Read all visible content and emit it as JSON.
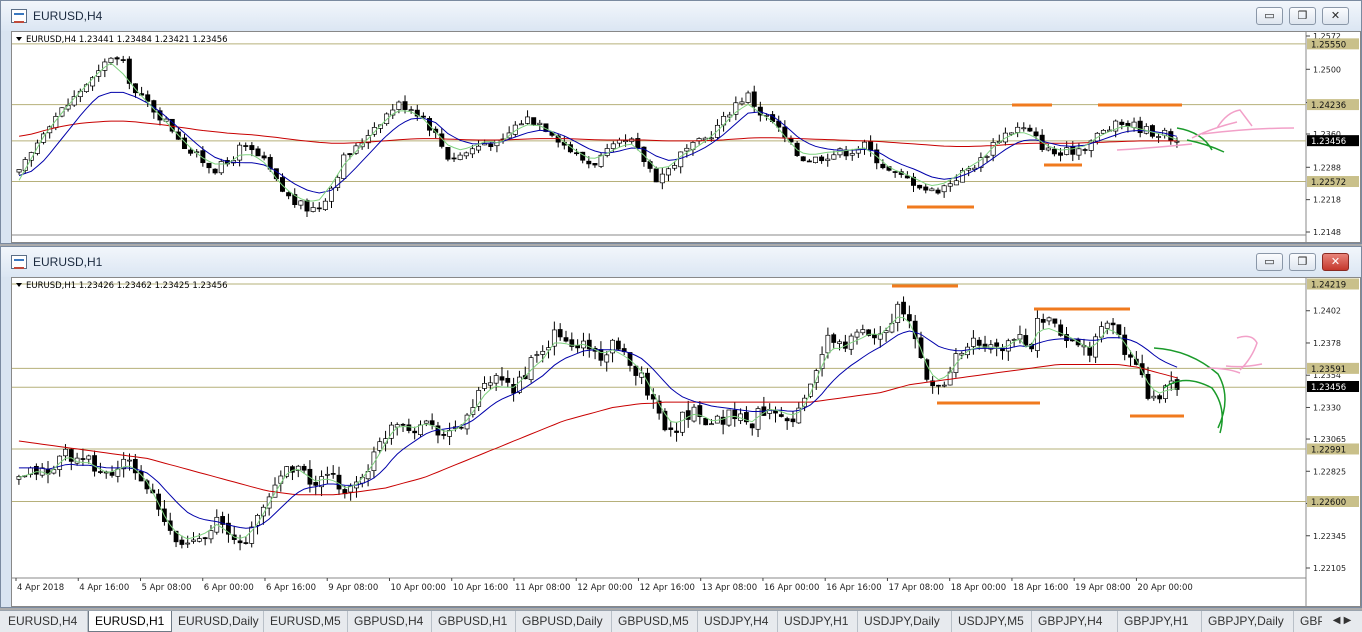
{
  "windows": [
    {
      "title": "EURUSD,H4",
      "info": "EURUSD,H4  1.23441 1.23484 1.23421 1.23456",
      "buttons": {
        "minimize": "▭",
        "maximize": "❐",
        "close": "✕"
      },
      "chart_data": {
        "type": "candlestick",
        "symbol": "EURUSD",
        "timeframe": "H4",
        "ohlc_current": {
          "open": 1.23441,
          "high": 1.23484,
          "low": 1.23421,
          "close": 1.23456
        },
        "ylim": [
          1.2148,
          1.2572
        ],
        "y_ticks": [
          1.2572,
          1.25,
          1.2428,
          1.236,
          1.2288,
          1.2218,
          1.2148
        ],
        "price_labels": [
          {
            "value": 1.2555,
            "text": "1.25550",
            "style": "level"
          },
          {
            "value": 1.24236,
            "text": "1.24236",
            "style": "level"
          },
          {
            "value": 1.23456,
            "text": "1.23456",
            "style": "current"
          },
          {
            "value": 1.22572,
            "text": "1.22572",
            "style": "level"
          }
        ],
        "horizontal_levels": [
          1.2555,
          1.24236,
          1.2345,
          1.22572
        ],
        "candle_count": 190,
        "close_path": [
          1.2275,
          1.232,
          1.2375,
          1.2405,
          1.243,
          1.2465,
          1.2485,
          1.253,
          1.251,
          1.2445,
          1.2425,
          1.2395,
          1.2365,
          1.2325,
          1.2305,
          1.2285,
          1.2295,
          1.233,
          1.232,
          1.2295,
          1.2245,
          1.2215,
          1.22,
          1.22,
          1.2245,
          1.231,
          1.233,
          1.237,
          1.2395,
          1.2425,
          1.242,
          1.24,
          1.236,
          1.231,
          1.2315,
          1.233,
          1.2345,
          1.2335,
          1.2375,
          1.2395,
          1.2385,
          1.2365,
          1.2335,
          1.231,
          1.2295,
          1.2315,
          1.2335,
          1.2345,
          1.2305,
          1.2265,
          1.2285,
          1.232,
          1.2335,
          1.2355,
          1.2385,
          1.2425,
          1.2445,
          1.2405,
          1.2385,
          1.2345,
          1.231,
          1.2305,
          1.2315,
          1.232,
          1.2325,
          1.2335,
          1.2305,
          1.2275,
          1.2265,
          1.2255,
          1.2235,
          1.2245,
          1.2265,
          1.2285,
          1.2305,
          1.2345,
          1.2365,
          1.2375,
          1.2355,
          1.2325,
          1.2315,
          1.2325,
          1.2335,
          1.236,
          1.2375,
          1.2385,
          1.2375,
          1.2365,
          1.236,
          1.2345
        ],
        "ma_fast_path": [
          1.226,
          1.231,
          1.236,
          1.2395,
          1.243,
          1.246,
          1.249,
          1.2515,
          1.249,
          1.2455,
          1.2425,
          1.2395,
          1.2365,
          1.2335,
          1.231,
          1.2295,
          1.2295,
          1.2315,
          1.2315,
          1.2295,
          1.2255,
          1.223,
          1.2215,
          1.2215,
          1.225,
          1.2295,
          1.2325,
          1.2355,
          1.2385,
          1.241,
          1.241,
          1.2395,
          1.2365,
          1.2335,
          1.2325,
          1.2335,
          1.2345,
          1.234,
          1.2365,
          1.238,
          1.2378,
          1.2365,
          1.234,
          1.232,
          1.2305,
          1.2315,
          1.233,
          1.234,
          1.2315,
          1.2285,
          1.229,
          1.2315,
          1.233,
          1.235,
          1.2375,
          1.2405,
          1.2425,
          1.2405,
          1.2385,
          1.235,
          1.232,
          1.2315,
          1.232,
          1.2322,
          1.2326,
          1.233,
          1.231,
          1.2285,
          1.2275,
          1.2262,
          1.2248,
          1.2252,
          1.2268,
          1.2288,
          1.2305,
          1.2335,
          1.2355,
          1.2365,
          1.2355,
          1.2335,
          1.2325,
          1.2328,
          1.2335,
          1.2355,
          1.2368,
          1.2378,
          1.2372,
          1.2365,
          1.2358,
          1.2348
        ],
        "ma_mid_path": [
          1.227,
          1.228,
          1.2305,
          1.234,
          1.2375,
          1.241,
          1.244,
          1.245,
          1.245,
          1.244,
          1.2425,
          1.2405,
          1.238,
          1.2355,
          1.233,
          1.231,
          1.23,
          1.2298,
          1.2298,
          1.2292,
          1.2275,
          1.2255,
          1.224,
          1.2232,
          1.2238,
          1.2262,
          1.229,
          1.232,
          1.235,
          1.2375,
          1.2392,
          1.2395,
          1.2385,
          1.236,
          1.2345,
          1.2338,
          1.234,
          1.2342,
          1.2352,
          1.2362,
          1.2368,
          1.2365,
          1.2355,
          1.234,
          1.2325,
          1.2318,
          1.2322,
          1.233,
          1.2328,
          1.2312,
          1.2302,
          1.2308,
          1.232,
          1.2335,
          1.2355,
          1.238,
          1.2405,
          1.2408,
          1.2398,
          1.2375,
          1.235,
          1.2335,
          1.2328,
          1.2325,
          1.2325,
          1.2327,
          1.2322,
          1.2305,
          1.2292,
          1.2282,
          1.2268,
          1.2262,
          1.2265,
          1.2275,
          1.229,
          1.231,
          1.233,
          1.2345,
          1.2348,
          1.2342,
          1.2335,
          1.2333,
          1.2336,
          1.2345,
          1.2355,
          1.2365,
          1.2368,
          1.2366,
          1.2362,
          1.2355
        ],
        "ma_slow_path": [
          1.2355,
          1.236,
          1.2368,
          1.2375,
          1.238,
          1.2384,
          1.2386,
          1.2388,
          1.2388,
          1.2386,
          1.2383,
          1.238,
          1.2376,
          1.2372,
          1.2368,
          1.2365,
          1.2362,
          1.236,
          1.2358,
          1.2355,
          1.2352,
          1.2348,
          1.2345,
          1.2342,
          1.234,
          1.234,
          1.2341,
          1.2343,
          1.2345,
          1.2347,
          1.2349,
          1.235,
          1.235,
          1.2349,
          1.2348,
          1.2347,
          1.2347,
          1.2347,
          1.2348,
          1.2349,
          1.235,
          1.235,
          1.235,
          1.2349,
          1.2348,
          1.2347,
          1.2347,
          1.2347,
          1.2347,
          1.2346,
          1.2345,
          1.2345,
          1.2345,
          1.2346,
          1.2347,
          1.2349,
          1.2351,
          1.2352,
          1.2352,
          1.2351,
          1.235,
          1.2349,
          1.2348,
          1.2347,
          1.2346,
          1.2345,
          1.2344,
          1.2342,
          1.234,
          1.2338,
          1.2336,
          1.2334,
          1.2333,
          1.2333,
          1.2334,
          1.2335,
          1.2337,
          1.2339,
          1.234,
          1.234,
          1.234,
          1.234,
          1.2341,
          1.2342,
          1.2343,
          1.2344,
          1.2345,
          1.2345,
          1.2345,
          1.2345
        ]
      }
    },
    {
      "title": "EURUSD,H1",
      "info": "EURUSD,H1  1.23426 1.23462 1.23425 1.23456",
      "buttons": {
        "minimize": "▭",
        "maximize": "❐",
        "close": "✕"
      },
      "chart_data": {
        "type": "candlestick",
        "symbol": "EURUSD",
        "timeframe": "H1",
        "ohlc_current": {
          "open": 1.23426,
          "high": 1.23462,
          "low": 1.23425,
          "close": 1.23456
        },
        "ylim": [
          1.22105,
          1.24219
        ],
        "y_ticks": [
          1.2402,
          1.2378,
          1.2354,
          1.233,
          1.23065,
          1.22825,
          1.22585,
          1.22345,
          1.22105
        ],
        "price_labels": [
          {
            "value": 1.24219,
            "text": "1.24219",
            "style": "level"
          },
          {
            "value": 1.23591,
            "text": "1.23591",
            "style": "level"
          },
          {
            "value": 1.2354,
            "text": "1.2354",
            "style": "tick"
          },
          {
            "value": 1.23456,
            "text": "1.23456",
            "style": "current"
          },
          {
            "value": 1.22991,
            "text": "1.22991",
            "style": "level"
          },
          {
            "value": 1.226,
            "text": "1.22600",
            "style": "level"
          }
        ],
        "horizontal_levels": [
          1.24219,
          1.23591,
          1.2345,
          1.22991,
          1.226
        ],
        "x_labels": [
          "4 Apr 2018",
          "4 Apr 16:00",
          "5 Apr 08:00",
          "6 Apr 00:00",
          "6 Apr 16:00",
          "9 Apr 08:00",
          "10 Apr 00:00",
          "10 Apr 16:00",
          "11 Apr 08:00",
          "12 Apr 00:00",
          "12 Apr 16:00",
          "13 Apr 08:00",
          "16 Apr 00:00",
          "16 Apr 16:00",
          "17 Apr 08:00",
          "18 Apr 00:00",
          "18 Apr 16:00",
          "19 Apr 08:00",
          "20 Apr 00:00"
        ],
        "candle_count": 200,
        "close_path": [
          1.2275,
          1.228,
          1.2285,
          1.2278,
          1.2292,
          1.2298,
          1.2287,
          1.229,
          1.2283,
          1.2279,
          1.2285,
          1.2289,
          1.2281,
          1.227,
          1.2255,
          1.2238,
          1.223,
          1.2228,
          1.2235,
          1.2238,
          1.2246,
          1.2236,
          1.2228,
          1.2233,
          1.2245,
          1.226,
          1.2275,
          1.2285,
          1.2288,
          1.2278,
          1.2272,
          1.2278,
          1.2275,
          1.2268,
          1.2272,
          1.2283,
          1.2295,
          1.231,
          1.2322,
          1.2318,
          1.2315,
          1.232,
          1.2317,
          1.231,
          1.2312,
          1.232,
          1.2333,
          1.2345,
          1.235,
          1.2345,
          1.2345,
          1.2355,
          1.2365,
          1.237,
          1.2385,
          1.238,
          1.2375,
          1.2378,
          1.2372,
          1.2368,
          1.2375,
          1.2368,
          1.2362,
          1.2352,
          1.2335,
          1.232,
          1.2312,
          1.2322,
          1.2328,
          1.2325,
          1.2318,
          1.2322,
          1.2326,
          1.2322,
          1.2318,
          1.2328,
          1.2332,
          1.2326,
          1.2322,
          1.2328,
          1.2348,
          1.237,
          1.2382,
          1.2375,
          1.238,
          1.2384,
          1.2388,
          1.2385,
          1.2395,
          1.2405,
          1.2392,
          1.2368,
          1.2345,
          1.2345,
          1.2358,
          1.2372,
          1.2378,
          1.2376,
          1.2375,
          1.2373,
          1.2377,
          1.2386,
          1.2368,
          1.2395,
          1.2392,
          1.2385,
          1.2382,
          1.2378,
          1.2372,
          1.238,
          1.2395,
          1.2383,
          1.237,
          1.2358,
          1.2342,
          1.2335,
          1.2345,
          1.2345
        ],
        "ma_fast_path": [
          1.2278,
          1.228,
          1.2283,
          1.228,
          1.2288,
          1.2294,
          1.2289,
          1.2289,
          1.2285,
          1.2281,
          1.2284,
          1.2287,
          1.2283,
          1.2274,
          1.226,
          1.2245,
          1.2236,
          1.2232,
          1.2234,
          1.2237,
          1.2243,
          1.2238,
          1.2232,
          1.2234,
          1.2242,
          1.2255,
          1.2268,
          1.228,
          1.2285,
          1.228,
          1.2275,
          1.2277,
          1.2275,
          1.227,
          1.2272,
          1.228,
          1.229,
          1.2303,
          1.2315,
          1.2316,
          1.2315,
          1.2318,
          1.2316,
          1.2312,
          1.2313,
          1.2318,
          1.2328,
          1.2339,
          1.2346,
          1.2345,
          1.2345,
          1.2352,
          1.236,
          1.2366,
          1.2378,
          1.2378,
          1.2376,
          1.2377,
          1.2374,
          1.237,
          1.2373,
          1.2369,
          1.2364,
          1.2356,
          1.2342,
          1.2328,
          1.2318,
          1.232,
          1.2325,
          1.2324,
          1.232,
          1.2321,
          1.2324,
          1.2322,
          1.2319,
          1.2325,
          1.2329,
          1.2327,
          1.2324,
          1.2327,
          1.2341,
          1.2359,
          1.2374,
          1.2374,
          1.2378,
          1.2381,
          1.2385,
          1.2384,
          1.2391,
          1.2399,
          1.2393,
          1.2376,
          1.2356,
          1.235,
          1.2355,
          1.2366,
          1.2373,
          1.2375,
          1.2375,
          1.2374,
          1.2376,
          1.2382,
          1.2372,
          1.2387,
          1.2389,
          1.2386,
          1.2383,
          1.2379,
          1.2374,
          1.2378,
          1.2389,
          1.2385,
          1.2375,
          1.2364,
          1.2349,
          1.234,
          1.2343,
          1.2344
        ],
        "ma_mid_path": [
          1.2285,
          1.2285,
          1.2285,
          1.2284,
          1.2286,
          1.2288,
          1.2287,
          1.2287,
          1.2286,
          1.2285,
          1.2285,
          1.2285,
          1.2284,
          1.2281,
          1.2275,
          1.2267,
          1.2259,
          1.2252,
          1.2248,
          1.2246,
          1.2245,
          1.2243,
          1.2241,
          1.224,
          1.2241,
          1.2245,
          1.2252,
          1.2259,
          1.2266,
          1.227,
          1.2271,
          1.2273,
          1.2273,
          1.2272,
          1.2272,
          1.2274,
          1.2278,
          1.2285,
          1.2294,
          1.23,
          1.2305,
          1.231,
          1.2313,
          1.2314,
          1.2315,
          1.2317,
          1.2321,
          1.2327,
          1.2333,
          1.2337,
          1.234,
          1.2344,
          1.2349,
          1.2354,
          1.2361,
          1.2366,
          1.2369,
          1.2372,
          1.2373,
          1.2373,
          1.2373,
          1.2372,
          1.237,
          1.2366,
          1.2359,
          1.2351,
          1.2343,
          1.2338,
          1.2335,
          1.2333,
          1.2331,
          1.233,
          1.2329,
          1.2328,
          1.2327,
          1.2327,
          1.2328,
          1.2328,
          1.2327,
          1.2328,
          1.2332,
          1.2339,
          1.2348,
          1.2355,
          1.2361,
          1.2366,
          1.2371,
          1.2375,
          1.238,
          1.2385,
          1.2387,
          1.2385,
          1.238,
          1.2375,
          1.2373,
          1.2372,
          1.2373,
          1.2374,
          1.2374,
          1.2374,
          1.2374,
          1.2376,
          1.2375,
          1.2378,
          1.238,
          1.2381,
          1.2381,
          1.2381,
          1.238,
          1.238,
          1.2382,
          1.2382,
          1.2381,
          1.2378,
          1.2373,
          1.2367,
          1.2363,
          1.236
        ],
        "ma_slow_path": [
          1.2305,
          1.2304,
          1.2303,
          1.2302,
          1.2301,
          1.23,
          1.2299,
          1.2298,
          1.2297,
          1.2296,
          1.2295,
          1.2294,
          1.2293,
          1.2292,
          1.229,
          1.2288,
          1.2286,
          1.2284,
          1.2282,
          1.228,
          1.2278,
          1.2276,
          1.2274,
          1.2272,
          1.227,
          1.2268,
          1.2267,
          1.2266,
          1.2265,
          1.2265,
          1.2265,
          1.2265,
          1.2265,
          1.2266,
          1.2267,
          1.2268,
          1.2269,
          1.227,
          1.2272,
          1.2274,
          1.2276,
          1.2278,
          1.2281,
          1.2284,
          1.2287,
          1.229,
          1.2293,
          1.2296,
          1.2299,
          1.2302,
          1.2305,
          1.2308,
          1.2311,
          1.2314,
          1.2317,
          1.232,
          1.2322,
          1.2324,
          1.2326,
          1.2328,
          1.233,
          1.2331,
          1.2332,
          1.2333,
          1.2333,
          1.2334,
          1.2334,
          1.2334,
          1.2334,
          1.2334,
          1.2334,
          1.2334,
          1.2334,
          1.2334,
          1.2334,
          1.2334,
          1.2334,
          1.2334,
          1.2334,
          1.2334,
          1.2334,
          1.2335,
          1.2336,
          1.2337,
          1.2338,
          1.2339,
          1.234,
          1.2341,
          1.2343,
          1.2345,
          1.2347,
          1.2348,
          1.2349,
          1.235,
          1.2351,
          1.2352,
          1.2353,
          1.2354,
          1.2355,
          1.2356,
          1.2357,
          1.2358,
          1.2359,
          1.236,
          1.2361,
          1.2362,
          1.2362,
          1.2362,
          1.2362,
          1.2362,
          1.2362,
          1.2362,
          1.2361,
          1.236,
          1.2358,
          1.2356,
          1.2354,
          1.2352
        ]
      }
    }
  ],
  "tabs": [
    "EURUSD,H4",
    "EURUSD,H1",
    "EURUSD,Daily",
    "EURUSD,M5",
    "GBPUSD,H4",
    "GBPUSD,H1",
    "GBPUSD,Daily",
    "GBPUSD,M5",
    "USDJPY,H4",
    "USDJPY,H1",
    "USDJPY,Daily",
    "USDJPY,M5",
    "GBPJPY,H4",
    "GBPJPY,H1",
    "GBPJPY,Daily",
    "GBP"
  ],
  "active_tab": 1,
  "tab_arrows": "◀ ▶",
  "colors": {
    "up_candle": "#ffffff",
    "down_candle": "#000000",
    "ma_fast": "#7fd27f",
    "ma_mid": "#0000aa",
    "ma_slow": "#c80000",
    "level_line": "#b6b07a",
    "level_label_bg": "#c9c08a",
    "current_label_bg": "#000000",
    "annotation_orange": "#f07a1e",
    "annotation_green": "#1a9a2a",
    "annotation_pink": "#f2a0c8"
  }
}
